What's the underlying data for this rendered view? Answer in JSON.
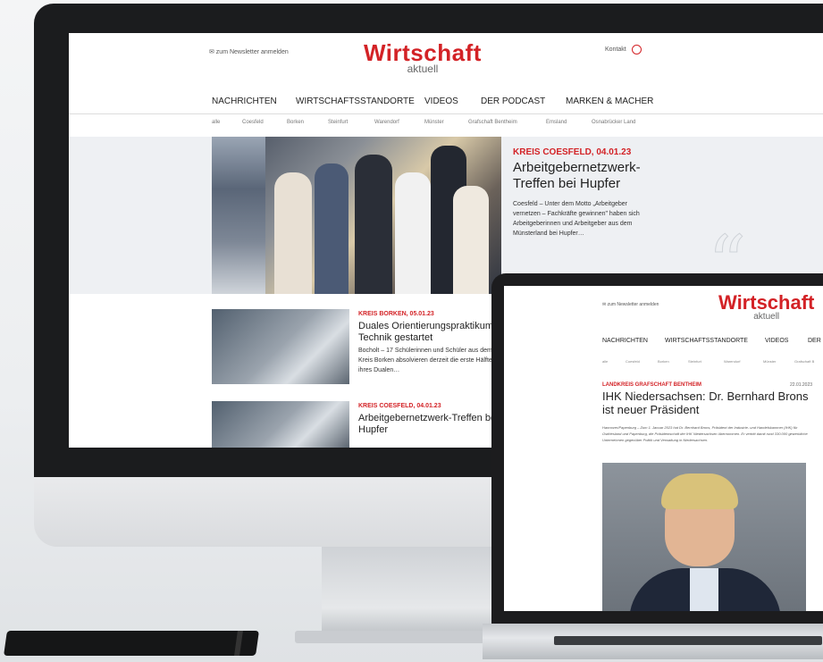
{
  "imac_site": {
    "newsletter_link": "✉ zum Newsletter anmelden",
    "logo_word": "Wirtschaft",
    "logo_sub": "aktuell",
    "kontakt": "Kontakt",
    "nav": [
      "NACHRICHTEN",
      "WIRTSCHAFTSSTANDORTE",
      "VIDEOS",
      "DER PODCAST",
      "MARKEN & MACHER"
    ],
    "subnav": [
      "alle",
      "Coesfeld",
      "Borken",
      "Steinfurt",
      "Warendorf",
      "Münster",
      "Grafschaft Bentheim",
      "Emsland",
      "Osnabrücker Land"
    ],
    "hero": {
      "kicker": "KREIS COESFELD, 04.01.23",
      "title": "Arbeitgebernetzwerk-Treffen bei Hupfer",
      "text": "Coesfeld – Unter dem Motto „Arbeitgeber vernetzen – Fachkräfte gewinnen\" haben sich Arbeitgeberinnen und Arbeitgeber aus dem Münsterland bei Hupfer…"
    },
    "cards": [
      {
        "kicker": "KREIS BORKEN, 05.01.23",
        "title": "Duales Orientierungspraktikum Technik gestartet",
        "text": "Bocholt – 17 Schülerinnen und Schüler aus dem Kreis Borken absolvieren derzeit die erste Hälfte ihres Dualen…"
      },
      {
        "kicker": "KREIS COESFELD, 04.01.23",
        "title": "Arbeitgebernetzwerk-Treffen bei Hupfer",
        "text": ""
      }
    ]
  },
  "laptop_site": {
    "newsletter_link": "✉ zum Newsletter anmelden",
    "logo_word": "Wirtschaft",
    "logo_sub": "aktuell",
    "nav": [
      "NACHRICHTEN",
      "WIRTSCHAFTSSTANDORTE",
      "VIDEOS",
      "DER"
    ],
    "subnav": [
      "alle",
      "Coesfeld",
      "Borken",
      "Steinfurt",
      "Warendorf",
      "Münster",
      "Grafschaft B"
    ],
    "article": {
      "kicker": "LANDKREIS GRAFSCHAFT BENTHEIM",
      "date": "22.01.2023",
      "title": "IHK Niedersachsen: Dr. Bernhard Brons ist neuer Präsident",
      "text": "Hannover/Papenburg – Zum 1. Januar 2023 hat Dr. Bernhard Brons, Präsident der Industrie- und Handelskammer (IHK) für Ostfriesland und Papenburg, die Präsidentschaft der IHK Niedersachsen übernommen. Er vertritt damit rund 330.000 gewerbliche Unternehmen gegenüber Politik und Verwaltung in Niedersachsen."
    }
  },
  "colors": {
    "brand_red": "#d32226",
    "text": "#222222"
  }
}
